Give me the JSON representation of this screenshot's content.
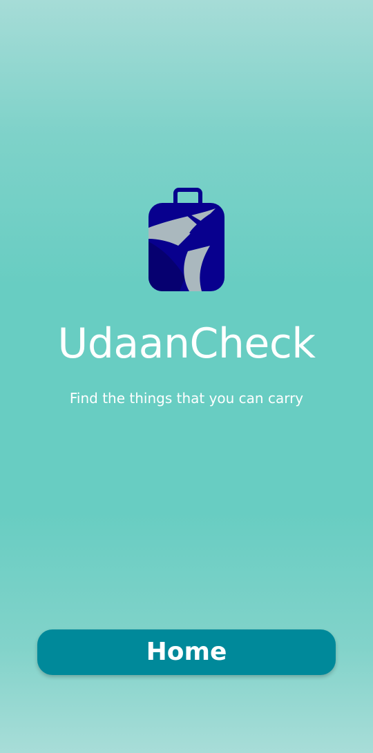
{
  "splash": {
    "app_title": "UdaanCheck",
    "tagline": "Find the things that you can carry",
    "logo_icon": "suitcase-airplane-icon"
  },
  "actions": {
    "home_label": "Home"
  },
  "colors": {
    "background": "#68cdc2",
    "button": "#00899a",
    "logo_case": "#08008e",
    "logo_plane": "#aab8be",
    "text": "#ffffff"
  }
}
